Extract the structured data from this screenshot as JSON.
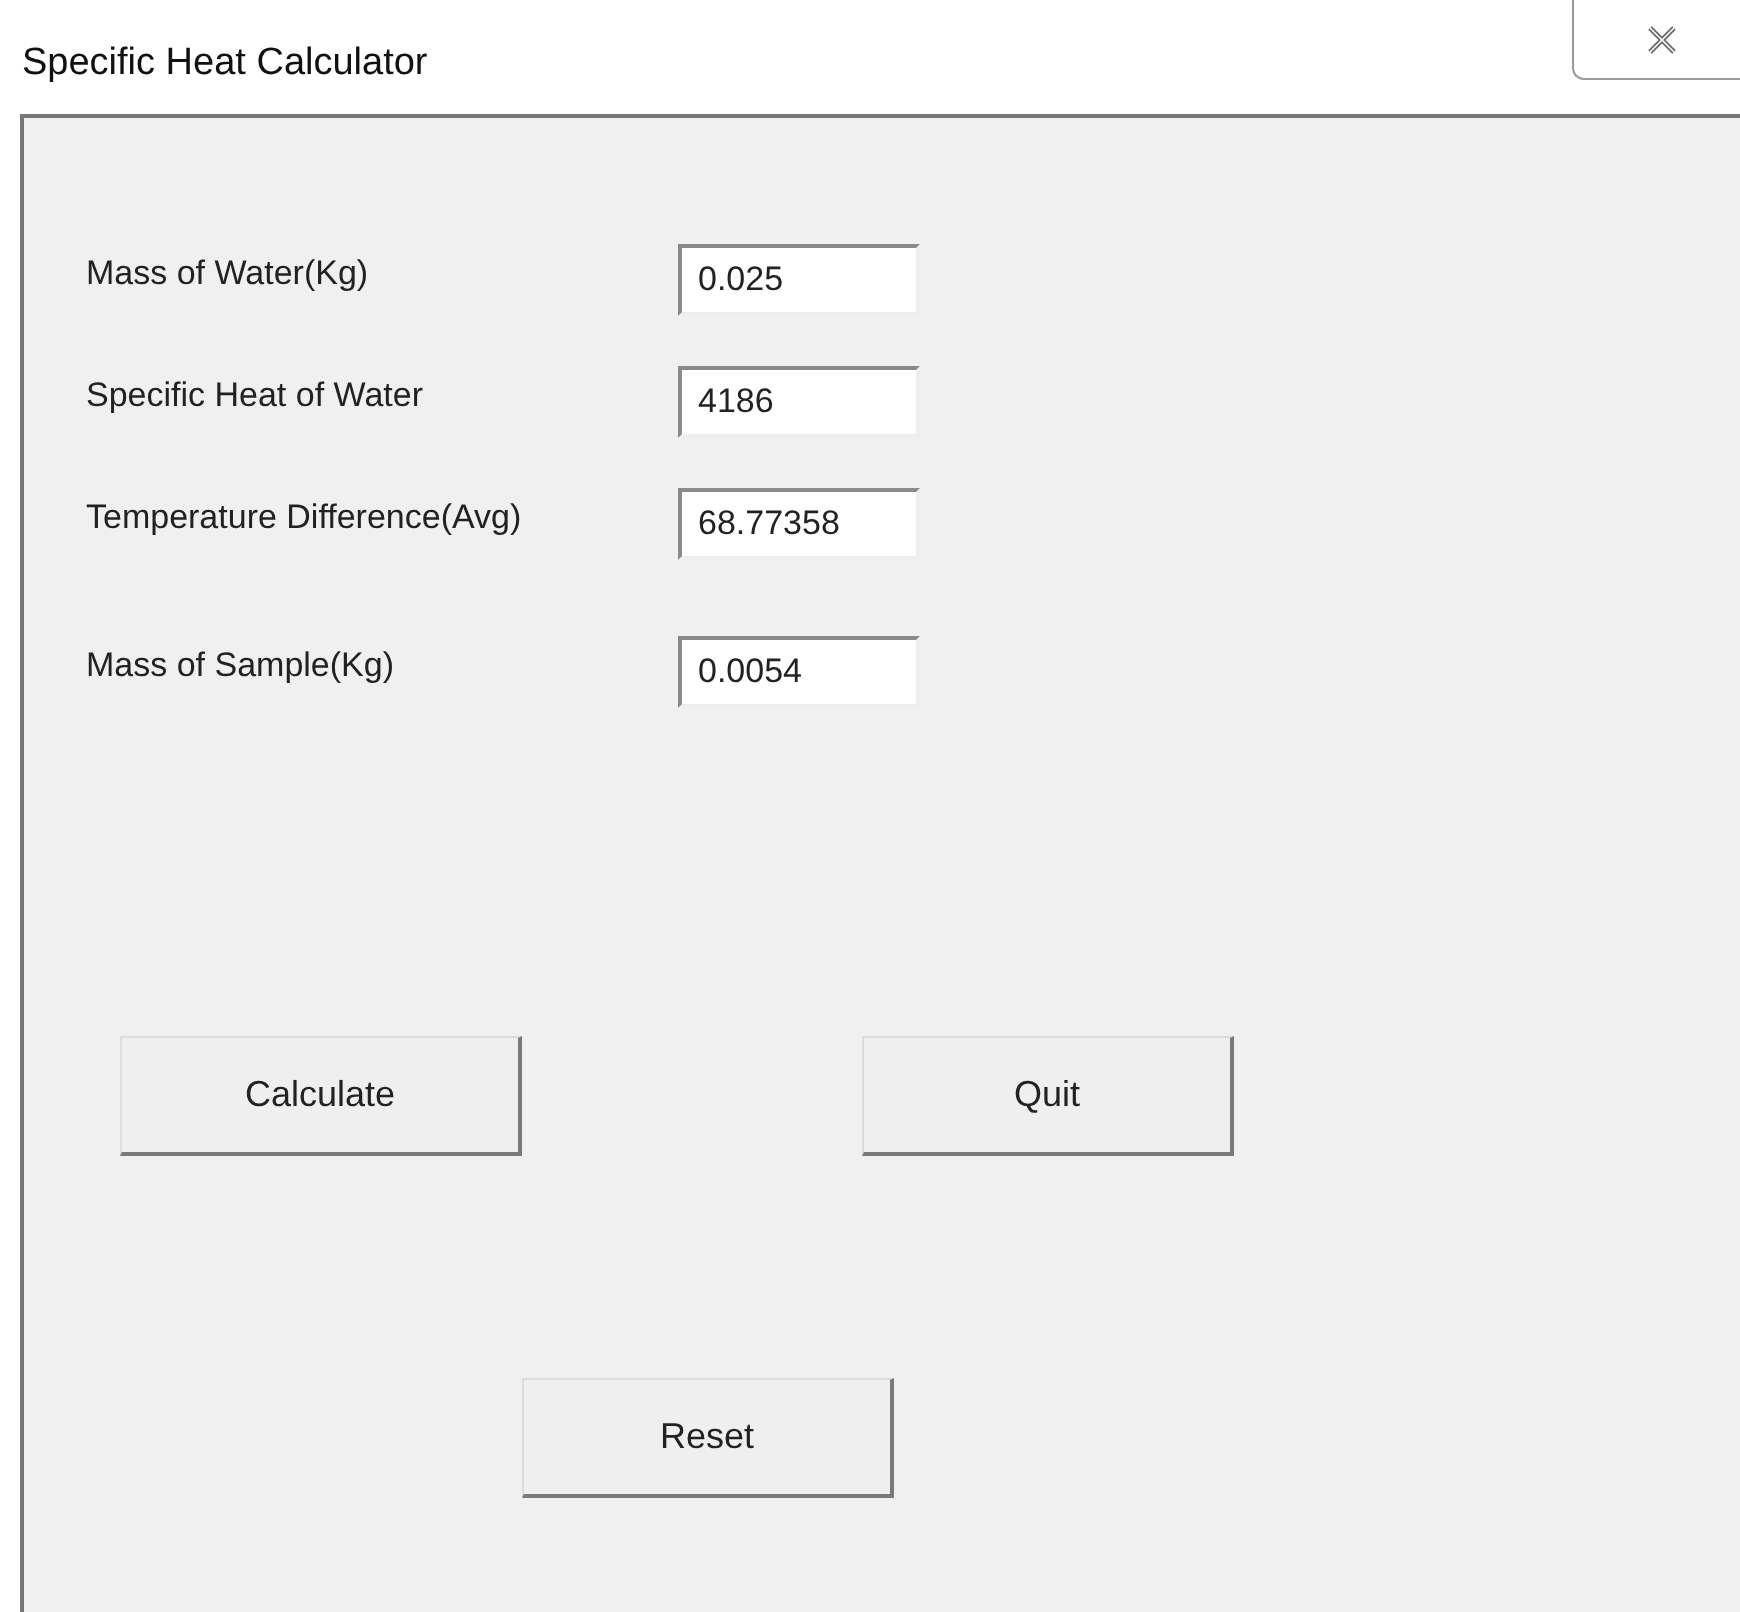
{
  "window": {
    "title": "Specific Heat Calculator"
  },
  "fields": [
    {
      "label": "Mass of Water(Kg)",
      "value": "0.025"
    },
    {
      "label": "Specific Heat of Water",
      "value": "4186"
    },
    {
      "label": "Temperature Difference(Avg)",
      "value": "68.77358"
    },
    {
      "label": "Mass of Sample(Kg)",
      "value": "0.0054"
    }
  ],
  "buttons": [
    "Calculate",
    "Quit",
    "Reset"
  ]
}
